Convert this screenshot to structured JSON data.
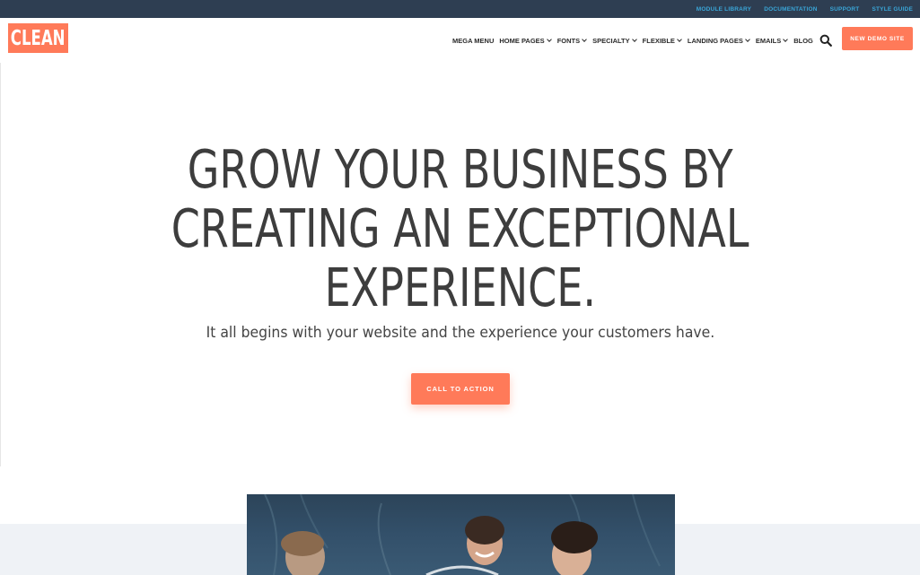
{
  "topbar": {
    "links": [
      "MODULE LIBRARY",
      "DOCUMENTATION",
      "SUPPORT",
      "STYLE GUIDE"
    ]
  },
  "header": {
    "logo_text": "CLEAN",
    "nav": [
      {
        "label": "MEGA MENU",
        "dropdown": false
      },
      {
        "label": "HOME PAGES",
        "dropdown": true
      },
      {
        "label": "FONTS",
        "dropdown": true
      },
      {
        "label": "SPECIALTY",
        "dropdown": true
      },
      {
        "label": "FLEXIBLE",
        "dropdown": true
      },
      {
        "label": "LANDING PAGES",
        "dropdown": true
      },
      {
        "label": "EMAILS",
        "dropdown": true
      },
      {
        "label": "BLOG",
        "dropdown": false
      }
    ],
    "search_icon": "search-icon",
    "cta_label": "NEW DEMO SITE"
  },
  "hero": {
    "title_lines": [
      "GROW YOUR BUSINESS BY",
      "CREATING AN EXCEPTIONAL",
      "EXPERIENCE."
    ],
    "subtitle": "It all begins with your website and the experience your customers have.",
    "cta_label": "CALL TO ACTION"
  },
  "colors": {
    "accent": "#ff7a59",
    "topbar_bg": "#2e3e52",
    "topbar_link": "#3aa6d8",
    "text": "#3d3d3d",
    "band_bg": "#eff2f6"
  }
}
